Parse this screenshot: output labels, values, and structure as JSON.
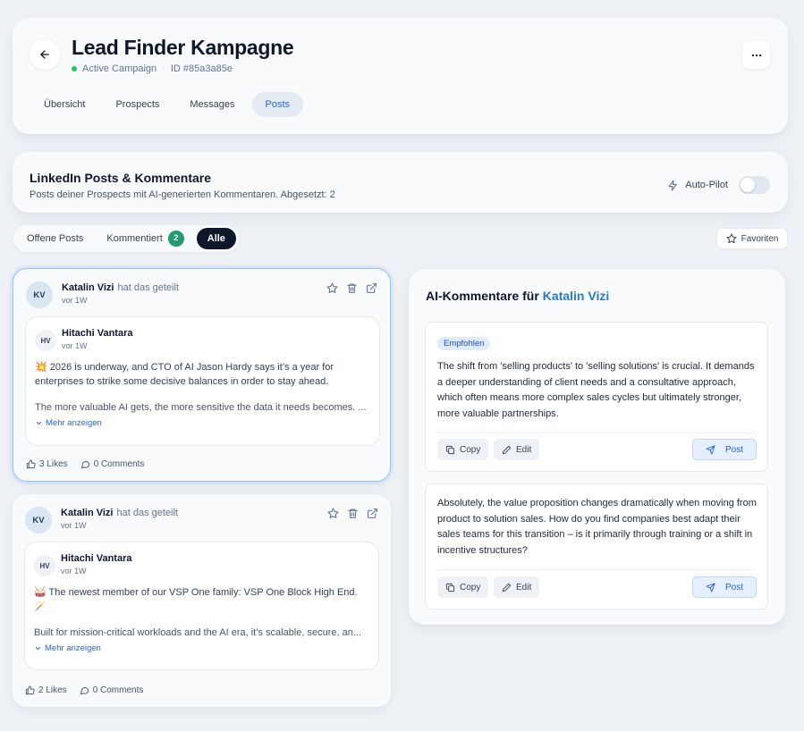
{
  "header": {
    "title": "Lead Finder Kampagne",
    "status": "Active Campaign",
    "id_label": "ID #85a3a85e",
    "tabs": [
      "Übersicht",
      "Prospects",
      "Messages",
      "Posts"
    ],
    "active_tab": "Posts"
  },
  "linkedin": {
    "title": "LinkedIn Posts & Kommentare",
    "subtitle": "Posts deiner Prospects mit AI-generierten Kommentaren. Abgesetzt: 2",
    "autopilot_label": "Auto-Pilot",
    "autopilot_on": false
  },
  "filters": {
    "open": "Offene Posts",
    "commented": "Kommentiert",
    "commented_count": "2",
    "all": "Alle",
    "favorites": "Favoriten"
  },
  "posts": [
    {
      "avatar": "KV",
      "author": "Katalin Vizi",
      "shared": "hat das geteilt",
      "time": "vor 1W",
      "company_avatar": "HV",
      "company": "Hitachi Vantara",
      "company_time": "vor 1W",
      "text": "💥 2026 is underway, and CTO of AI Jason Hardy  says it’s a year for enterprises to strike some decisive balances in order to stay ahead.",
      "text2": "The more valuable AI gets, the more sensitive the data it needs becomes. ...",
      "more": "Mehr anzeigen",
      "likes": "3 Likes",
      "comments": "0 Comments"
    },
    {
      "avatar": "KV",
      "author": "Katalin Vizi",
      "shared": "hat das geteilt",
      "time": "vor 1W",
      "company_avatar": "HV",
      "company": "Hitachi Vantara",
      "company_time": "vor 1W",
      "text": "🥁 The newest member of our VSP One family: VSP One Block High End. 🪄",
      "text2": "Built for mission-critical workloads and the AI era, it’s scalable, secure, an...",
      "more": "Mehr anzeigen",
      "likes": "2 Likes",
      "comments": "0 Comments"
    }
  ],
  "ai": {
    "title": "AI-Kommentare für",
    "lead_name": "Katalin Vizi",
    "recommended": "Empfohlen",
    "comments": [
      "The shift from 'selling products' to 'selling solutions' is crucial. It demands a deeper understanding of client needs and a consultative approach, which often means more complex sales cycles but ultimately stronger, more valuable partnerships.",
      "Absolutely, the value proposition changes dramatically when moving from product to solution sales. How do you find companies best adapt their sales teams for this transition – is it primarily through training or a shift in incentive structures?"
    ],
    "copy_label": "Copy",
    "edit_label": "Edit",
    "post_label": "Post"
  },
  "colors": {
    "accent": "#2563eb",
    "lead_link": "#2b7ac4",
    "status_green": "#22c55e",
    "badge_green": "#1f9d6c"
  }
}
